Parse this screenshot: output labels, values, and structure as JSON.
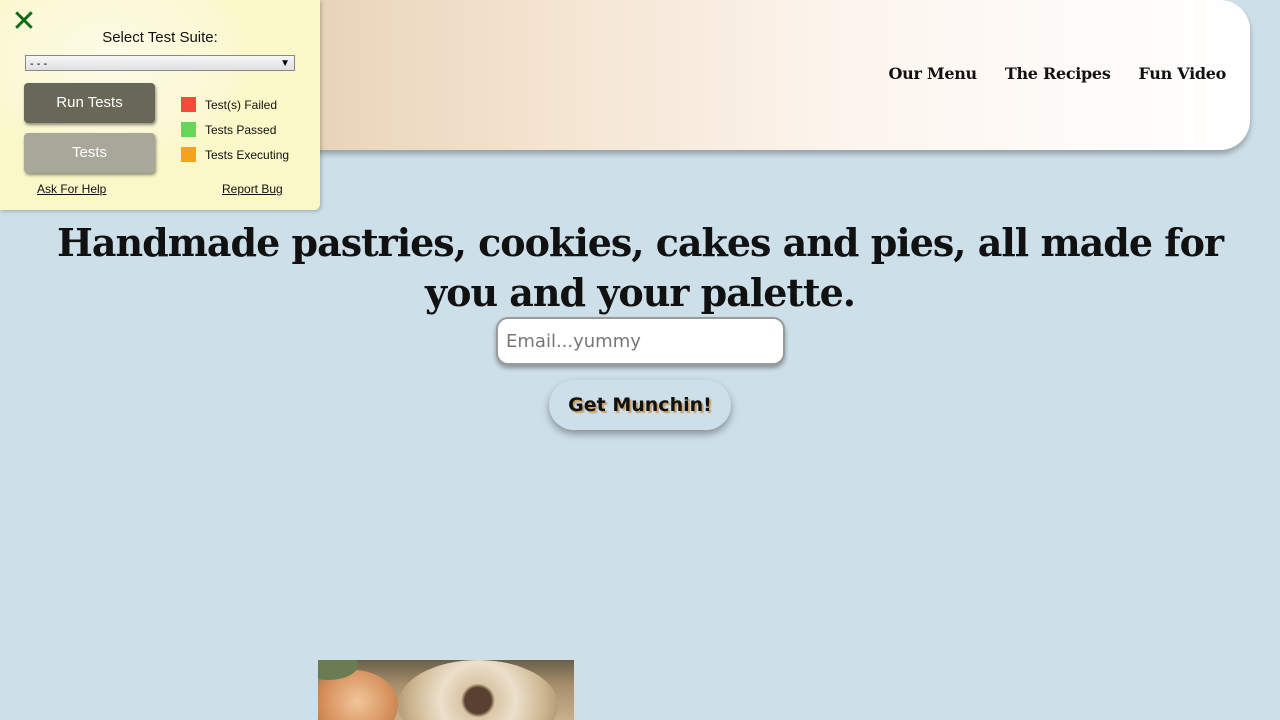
{
  "test_panel": {
    "close_icon": "close-x-icon",
    "select_label": "Select Test Suite:",
    "select_value": "- - -",
    "run_button": "Run Tests",
    "tests_button": "Tests",
    "legend": [
      {
        "label": "Test(s) Failed",
        "color": "#f24b3a"
      },
      {
        "label": "Tests Passed",
        "color": "#64d65a"
      },
      {
        "label": "Tests Executing",
        "color": "#f7a31a"
      }
    ],
    "help_link": "Ask For Help",
    "bug_link": "Report Bug"
  },
  "header": {
    "nav": [
      "Our Menu",
      "The Recipes",
      "Fun Video"
    ]
  },
  "hero": {
    "title": "Handmade pastries, cookies, cakes and pies, all made for you and your palette.",
    "email_placeholder": "Email...yummy",
    "cta_label": "Get Munchin!"
  },
  "colors": {
    "page_background": "#cddfe8",
    "close_icon": "#0e6b17",
    "run_button": "#686858",
    "tests_button": "#a8a89a"
  }
}
